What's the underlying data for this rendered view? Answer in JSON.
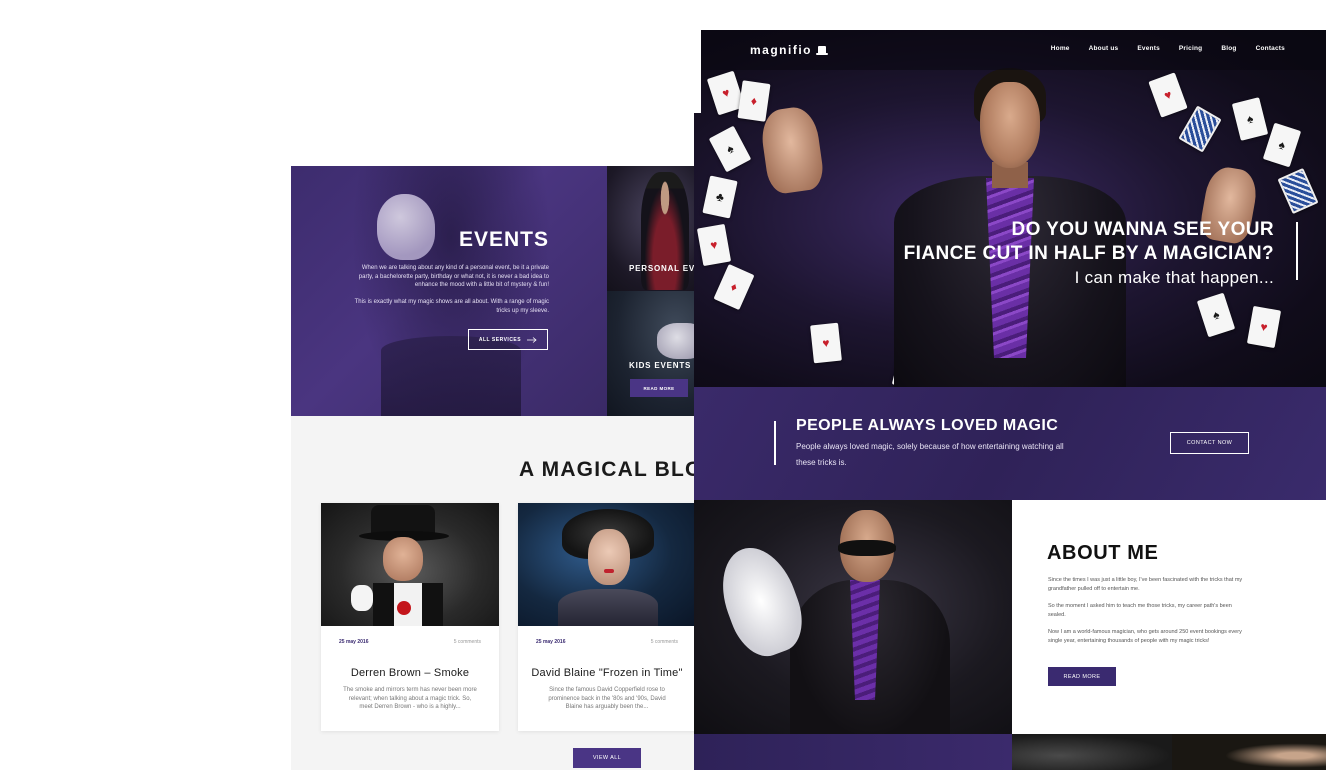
{
  "back_page": {
    "events": {
      "title": "EVENTS",
      "paragraph_1": "When we are talking about any kind of a personal event, be it a private party, a bachelorette party, birthday or what not, it is never a bad idea to enhance the mood with a little bit of mystery & fun!",
      "paragraph_2": "This is exactly what my magic shows are all about. With a range of magic tricks up my sleeve.",
      "button_label": "ALL SERVICES",
      "button_icon": "arrow-right-icon"
    },
    "tiles": [
      {
        "label": "PERSONAL EVE"
      },
      {
        "label": "KIDS EVENTS",
        "button_label": "READ MORE"
      }
    ],
    "blog": {
      "title": "A MAGICAL BLOG",
      "posts": [
        {
          "date": "25 may 2016",
          "comments": "5 comments",
          "title": "Derren Brown – Smoke",
          "excerpt": "The smoke and mirrors term has never been more relevant; when talking about a magic trick. So, meet Derren Brown - who is a highly..."
        },
        {
          "date": "25 may 2016",
          "comments": "5 comments",
          "title": "David Blaine \"Frozen in Time\"",
          "excerpt": "Since the famous David Copperfield rose to prominence back in the '80s and '90s, David Blaine has arguably been the..."
        }
      ],
      "view_all_label": "VIEW ALL"
    }
  },
  "front_page": {
    "nav": {
      "logo": "magnifio",
      "logo_icon": "top-hat-wand-icon",
      "links": [
        "Home",
        "About us",
        "Events",
        "Pricing",
        "Blog",
        "Contacts"
      ]
    },
    "hero": {
      "line_1": "DO YOU WANNA SEE YOUR",
      "line_2": "FIANCE CUT IN HALF BY A MAGICIAN?",
      "line_3": "I can make that happen..."
    },
    "band": {
      "title": "PEOPLE ALWAYS LOVED MAGIC",
      "text": "People always loved magic, solely because of how entertaining watching all these tricks is.",
      "button_label": "CONTACT NOW"
    },
    "about": {
      "title": "ABOUT ME",
      "paragraph_1": "Since the times I was just a little boy, I've been fascinated with the tricks that my grandfather pulled off to entertain me.",
      "paragraph_2": "So the moment I asked him to teach me those tricks, my career path's been sealed.",
      "paragraph_3": "Now I am a world-famous magician, who gets around 250 event bookings every single year, entertaining thousands of people with my magic tricks!",
      "button_label": "READ MORE"
    }
  },
  "colors": {
    "accent": "#4a3585",
    "dark_purple": "#2f2258",
    "hero_bg": "#1d1530",
    "text_dark": "#1a1a1a"
  }
}
